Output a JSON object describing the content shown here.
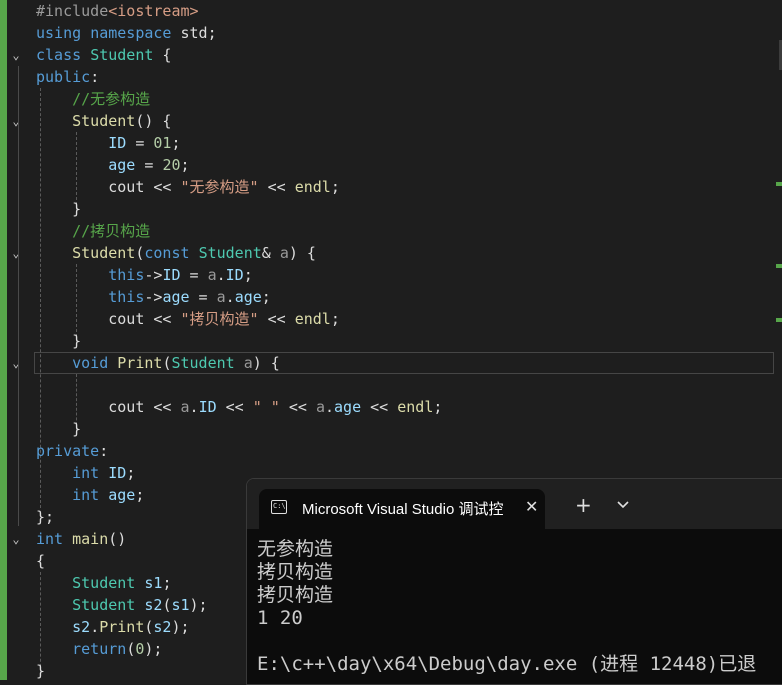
{
  "editor": {
    "lines": [
      {
        "tokens": [
          [
            "pp",
            "#include"
          ],
          [
            "inc",
            "<iostream>"
          ]
        ]
      },
      {
        "tokens": [
          [
            "kw",
            "using"
          ],
          [
            "tx",
            " "
          ],
          [
            "kw",
            "namespace"
          ],
          [
            "tx",
            " std;"
          ]
        ]
      },
      {
        "tokens": [
          [
            "kw",
            "class"
          ],
          [
            "tx",
            " "
          ],
          [
            "ty",
            "Student"
          ],
          [
            "tx",
            " {"
          ]
        ]
      },
      {
        "tokens": [
          [
            "kw",
            "public"
          ],
          [
            "tx",
            ":"
          ]
        ]
      },
      {
        "tokens": [
          [
            "tx",
            "    "
          ],
          [
            "cm",
            "//无参构造"
          ]
        ]
      },
      {
        "tokens": [
          [
            "tx",
            "    "
          ],
          [
            "fn",
            "Student"
          ],
          [
            "tx",
            "() {"
          ]
        ]
      },
      {
        "tokens": [
          [
            "tx",
            "        "
          ],
          [
            "vr",
            "ID"
          ],
          [
            "tx",
            " = "
          ],
          [
            "nm",
            "01"
          ],
          [
            "tx",
            ";"
          ]
        ]
      },
      {
        "tokens": [
          [
            "tx",
            "        "
          ],
          [
            "vr",
            "age"
          ],
          [
            "tx",
            " = "
          ],
          [
            "nm",
            "20"
          ],
          [
            "tx",
            ";"
          ]
        ]
      },
      {
        "tokens": [
          [
            "tx",
            "        cout << "
          ],
          [
            "st",
            "\"无参构造\""
          ],
          [
            "tx",
            " << "
          ],
          [
            "fn",
            "endl"
          ],
          [
            "tx",
            ";"
          ]
        ]
      },
      {
        "tokens": [
          [
            "tx",
            "    }"
          ]
        ]
      },
      {
        "tokens": [
          [
            "tx",
            "    "
          ],
          [
            "cm",
            "//拷贝构造"
          ]
        ]
      },
      {
        "tokens": [
          [
            "tx",
            "    "
          ],
          [
            "fn",
            "Student"
          ],
          [
            "tx",
            "("
          ],
          [
            "kw",
            "const"
          ],
          [
            "tx",
            " "
          ],
          [
            "ty",
            "Student"
          ],
          [
            "tx",
            "& "
          ],
          [
            "pa",
            "a"
          ],
          [
            "tx",
            ") {"
          ]
        ]
      },
      {
        "tokens": [
          [
            "tx",
            "        "
          ],
          [
            "kw",
            "this"
          ],
          [
            "tx",
            "->"
          ],
          [
            "vr",
            "ID"
          ],
          [
            "tx",
            " = "
          ],
          [
            "pa",
            "a"
          ],
          [
            "tx",
            "."
          ],
          [
            "vr",
            "ID"
          ],
          [
            "tx",
            ";"
          ]
        ]
      },
      {
        "tokens": [
          [
            "tx",
            "        "
          ],
          [
            "kw",
            "this"
          ],
          [
            "tx",
            "->"
          ],
          [
            "vr",
            "age"
          ],
          [
            "tx",
            " = "
          ],
          [
            "pa",
            "a"
          ],
          [
            "tx",
            "."
          ],
          [
            "vr",
            "age"
          ],
          [
            "tx",
            ";"
          ]
        ]
      },
      {
        "tokens": [
          [
            "tx",
            "        cout << "
          ],
          [
            "st",
            "\"拷贝构造\""
          ],
          [
            "tx",
            " << "
          ],
          [
            "fn",
            "endl"
          ],
          [
            "tx",
            ";"
          ]
        ]
      },
      {
        "tokens": [
          [
            "tx",
            "    }"
          ]
        ]
      },
      {
        "tokens": [
          [
            "tx",
            "    "
          ],
          [
            "kw",
            "void"
          ],
          [
            "tx",
            " "
          ],
          [
            "fn",
            "Print"
          ],
          [
            "tx",
            "("
          ],
          [
            "ty",
            "Student"
          ],
          [
            "tx",
            " "
          ],
          [
            "pa",
            "a"
          ],
          [
            "tx",
            ") {"
          ]
        ]
      },
      {
        "tokens": [
          [
            "tx",
            ""
          ]
        ]
      },
      {
        "tokens": [
          [
            "tx",
            "        cout << "
          ],
          [
            "pa",
            "a"
          ],
          [
            "tx",
            "."
          ],
          [
            "vr",
            "ID"
          ],
          [
            "tx",
            " << "
          ],
          [
            "st",
            "\" \""
          ],
          [
            "tx",
            " << "
          ],
          [
            "pa",
            "a"
          ],
          [
            "tx",
            "."
          ],
          [
            "vr",
            "age"
          ],
          [
            "tx",
            " << "
          ],
          [
            "fn",
            "endl"
          ],
          [
            "tx",
            ";"
          ]
        ]
      },
      {
        "tokens": [
          [
            "tx",
            "    }"
          ]
        ]
      },
      {
        "tokens": [
          [
            "kw",
            "private"
          ],
          [
            "tx",
            ":"
          ]
        ]
      },
      {
        "tokens": [
          [
            "tx",
            "    "
          ],
          [
            "kw",
            "int"
          ],
          [
            "tx",
            " "
          ],
          [
            "vr",
            "ID"
          ],
          [
            "tx",
            ";"
          ]
        ]
      },
      {
        "tokens": [
          [
            "tx",
            "    "
          ],
          [
            "kw",
            "int"
          ],
          [
            "tx",
            " "
          ],
          [
            "vr",
            "age"
          ],
          [
            "tx",
            ";"
          ]
        ]
      },
      {
        "tokens": [
          [
            "tx",
            "};"
          ]
        ]
      },
      {
        "tokens": [
          [
            "kw",
            "int"
          ],
          [
            "tx",
            " "
          ],
          [
            "fn",
            "main"
          ],
          [
            "tx",
            "()"
          ]
        ]
      },
      {
        "tokens": [
          [
            "tx",
            "{"
          ]
        ]
      },
      {
        "tokens": [
          [
            "tx",
            "    "
          ],
          [
            "ty",
            "Student"
          ],
          [
            "tx",
            " "
          ],
          [
            "vr",
            "s1"
          ],
          [
            "tx",
            ";"
          ]
        ]
      },
      {
        "tokens": [
          [
            "tx",
            "    "
          ],
          [
            "ty",
            "Student"
          ],
          [
            "tx",
            " "
          ],
          [
            "vr",
            "s2"
          ],
          [
            "tx",
            "("
          ],
          [
            "vr",
            "s1"
          ],
          [
            "tx",
            ");"
          ]
        ]
      },
      {
        "tokens": [
          [
            "tx",
            "    "
          ],
          [
            "vr",
            "s2"
          ],
          [
            "tx",
            "."
          ],
          [
            "fn",
            "Print"
          ],
          [
            "tx",
            "("
          ],
          [
            "vr",
            "s2"
          ],
          [
            "tx",
            ");"
          ]
        ]
      },
      {
        "tokens": [
          [
            "tx",
            "    "
          ],
          [
            "kw",
            "return"
          ],
          [
            "tx",
            "("
          ],
          [
            "nm",
            "0"
          ],
          [
            "tx",
            ");"
          ]
        ]
      },
      {
        "tokens": [
          [
            "tx",
            "}"
          ]
        ]
      }
    ]
  },
  "console": {
    "tab_title": "Microsoft Visual Studio 调试控",
    "tab_icon_label": "C:\\",
    "close_icon": "close-icon",
    "new_tab_icon": "plus-icon",
    "menu_icon": "chevron-down-icon",
    "lines": [
      "无参构造",
      "拷贝构造",
      "拷贝构造",
      "1 20",
      "",
      "E:\\c++\\day\\x64\\Debug\\day.exe (进程 12448)已退"
    ]
  },
  "colors": {
    "editor_bg": "#1e1e1e",
    "change_bar": "#57a64a",
    "console_bg": "#0c0c0c"
  }
}
